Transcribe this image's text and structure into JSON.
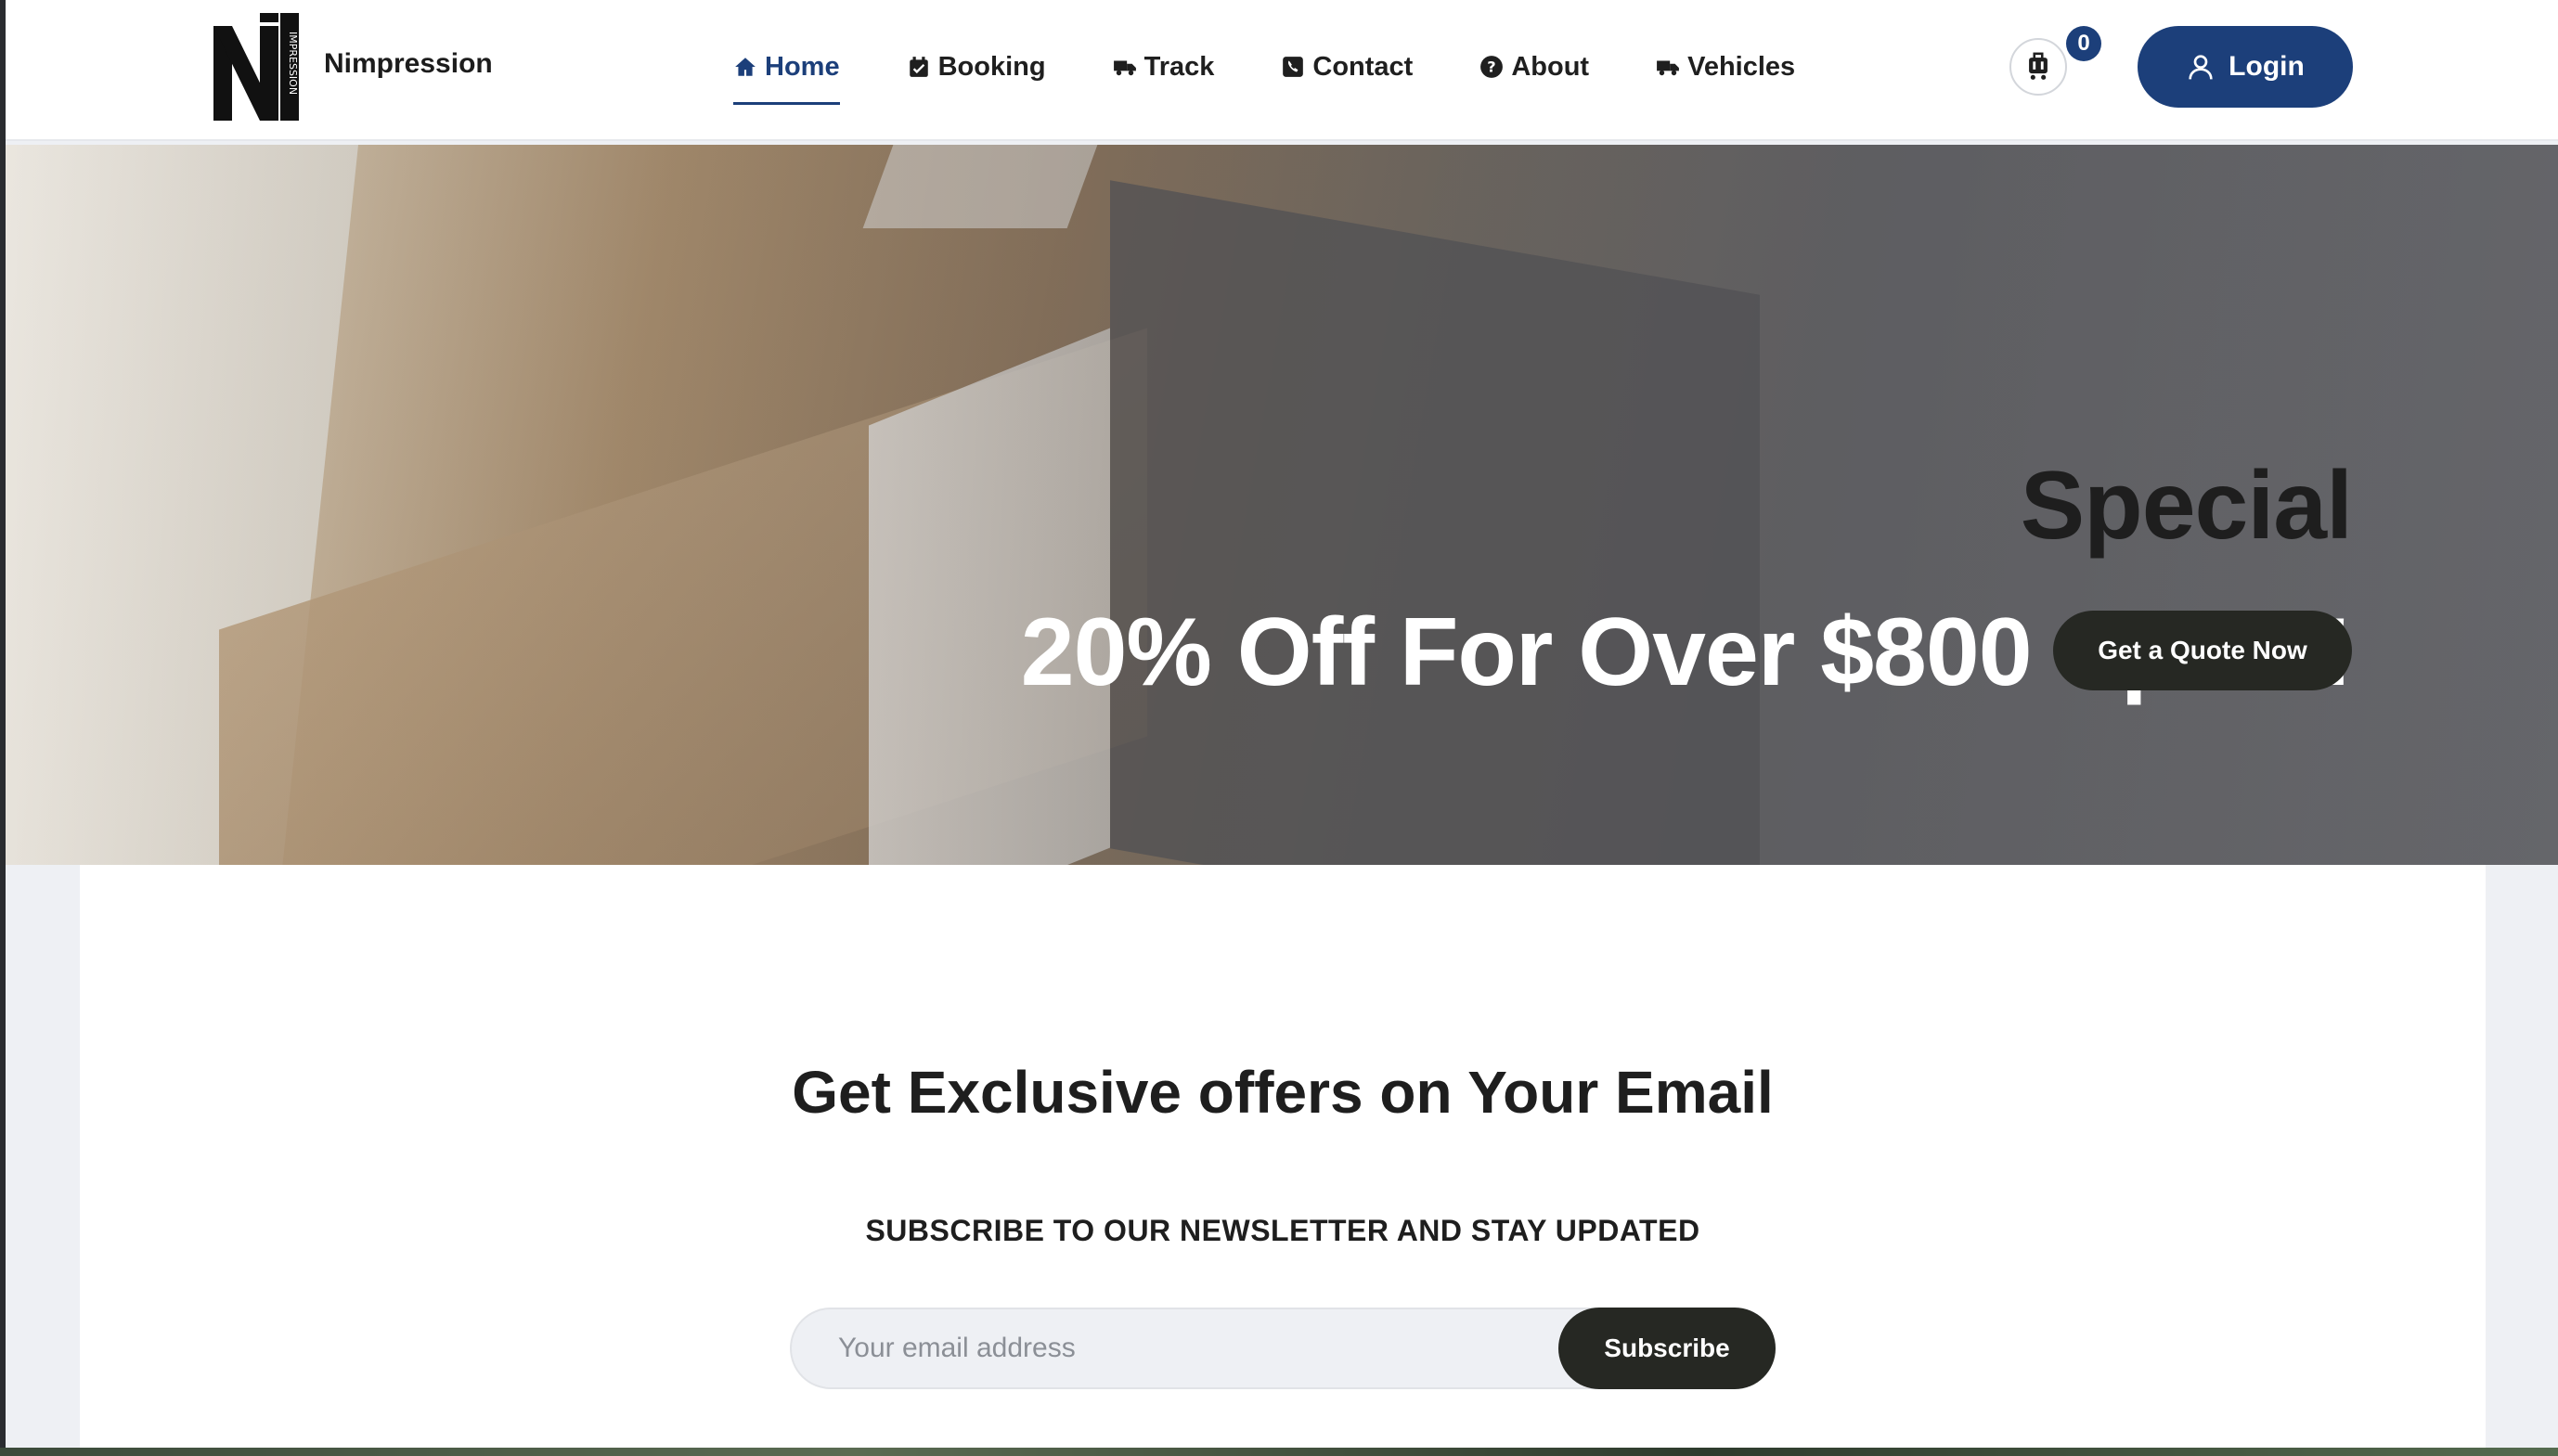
{
  "brand": {
    "name": "Nimpression",
    "logo_letter": "N",
    "logo_side_text": "IMPRESSION"
  },
  "nav": {
    "items": [
      {
        "label": "Home",
        "icon": "home-icon",
        "active": true
      },
      {
        "label": "Booking",
        "icon": "calendar-check-icon",
        "active": false
      },
      {
        "label": "Track",
        "icon": "truck-icon",
        "active": false
      },
      {
        "label": "Contact",
        "icon": "phone-icon",
        "active": false
      },
      {
        "label": "About",
        "icon": "question-circle-icon",
        "active": false
      },
      {
        "label": "Vehicles",
        "icon": "truck-icon",
        "active": false
      }
    ]
  },
  "cart": {
    "icon": "luggage-cart-icon",
    "count": "0"
  },
  "login": {
    "label": "Login",
    "icon": "user-icon"
  },
  "hero": {
    "kicker": "Special",
    "headline": "20% Off For Over $800 Spent!",
    "cta_label": "Get a Quote Now"
  },
  "newsletter": {
    "title": "Get Exclusive offers on Your Email",
    "subtitle": "SUBSCRIBE TO OUR NEWSLETTER AND STAY UPDATED",
    "email_placeholder": "Your email address",
    "subscribe_label": "Subscribe"
  },
  "colors": {
    "accent": "#1c3f7a",
    "dark_button": "#262823",
    "text": "#1e1e1e"
  }
}
